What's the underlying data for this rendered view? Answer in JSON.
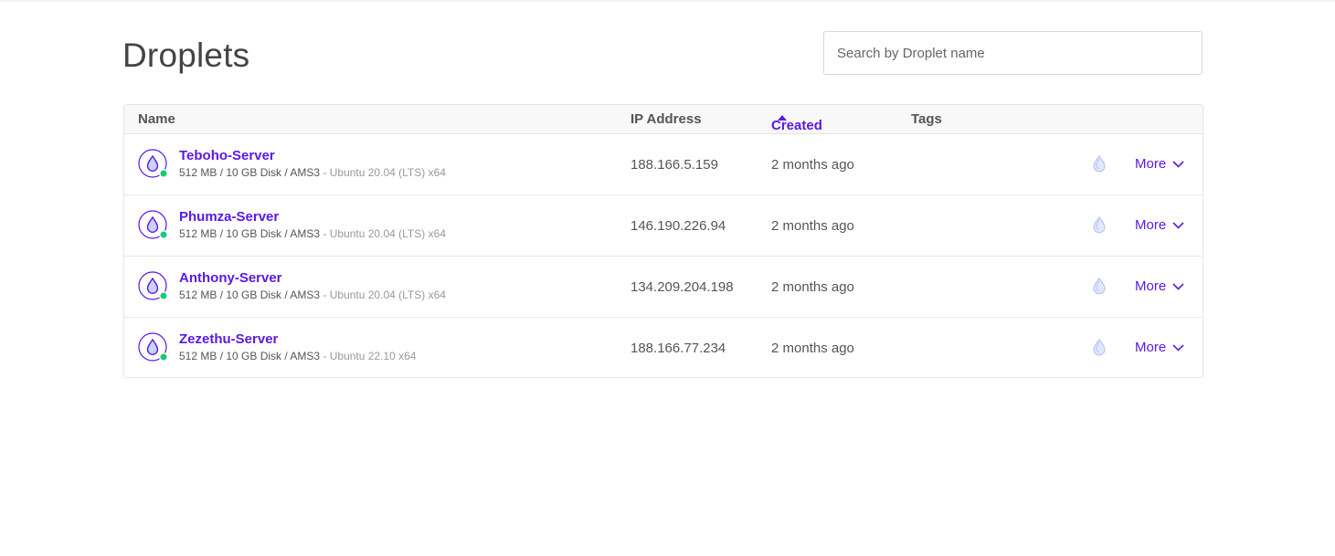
{
  "page": {
    "title": "Droplets"
  },
  "search": {
    "placeholder": "Search by Droplet name"
  },
  "table": {
    "headers": {
      "name": "Name",
      "ip": "IP Address",
      "created": "Created",
      "tags": "Tags"
    },
    "sort": {
      "column": "created",
      "direction": "ascending"
    },
    "rows": [
      {
        "name": "Teboho-Server",
        "specs": "512 MB / 10 GB Disk / AMS3",
        "os": " - Ubuntu 20.04 (LTS) x64",
        "ip": "188.166.5.159",
        "created": "2 months ago",
        "more": "More",
        "status": "active"
      },
      {
        "name": "Phumza-Server",
        "specs": "512 MB / 10 GB Disk / AMS3",
        "os": " - Ubuntu 20.04 (LTS) x64",
        "ip": "146.190.226.94",
        "created": "2 months ago",
        "more": "More",
        "status": "active"
      },
      {
        "name": "Anthony-Server",
        "specs": "512 MB / 10 GB Disk / AMS3",
        "os": " - Ubuntu 20.04 (LTS) x64",
        "ip": "134.209.204.198",
        "created": "2 months ago",
        "more": "More",
        "status": "active"
      },
      {
        "name": "Zezethu-Server",
        "specs": "512 MB / 10 GB Disk / AMS3",
        "os": " - Ubuntu 22.10 x64",
        "ip": "188.166.77.234",
        "created": "2 months ago",
        "more": "More",
        "status": "active"
      }
    ]
  },
  "icons": {
    "droplet": "droplet-icon",
    "status": "status-dot-icon",
    "backup": "droplet-outline-icon",
    "chevron": "chevron-down-icon"
  },
  "colors": {
    "accent": "#5b19e6",
    "status_active": "#15cd72",
    "droplet_fill": "#c9d3fb"
  }
}
